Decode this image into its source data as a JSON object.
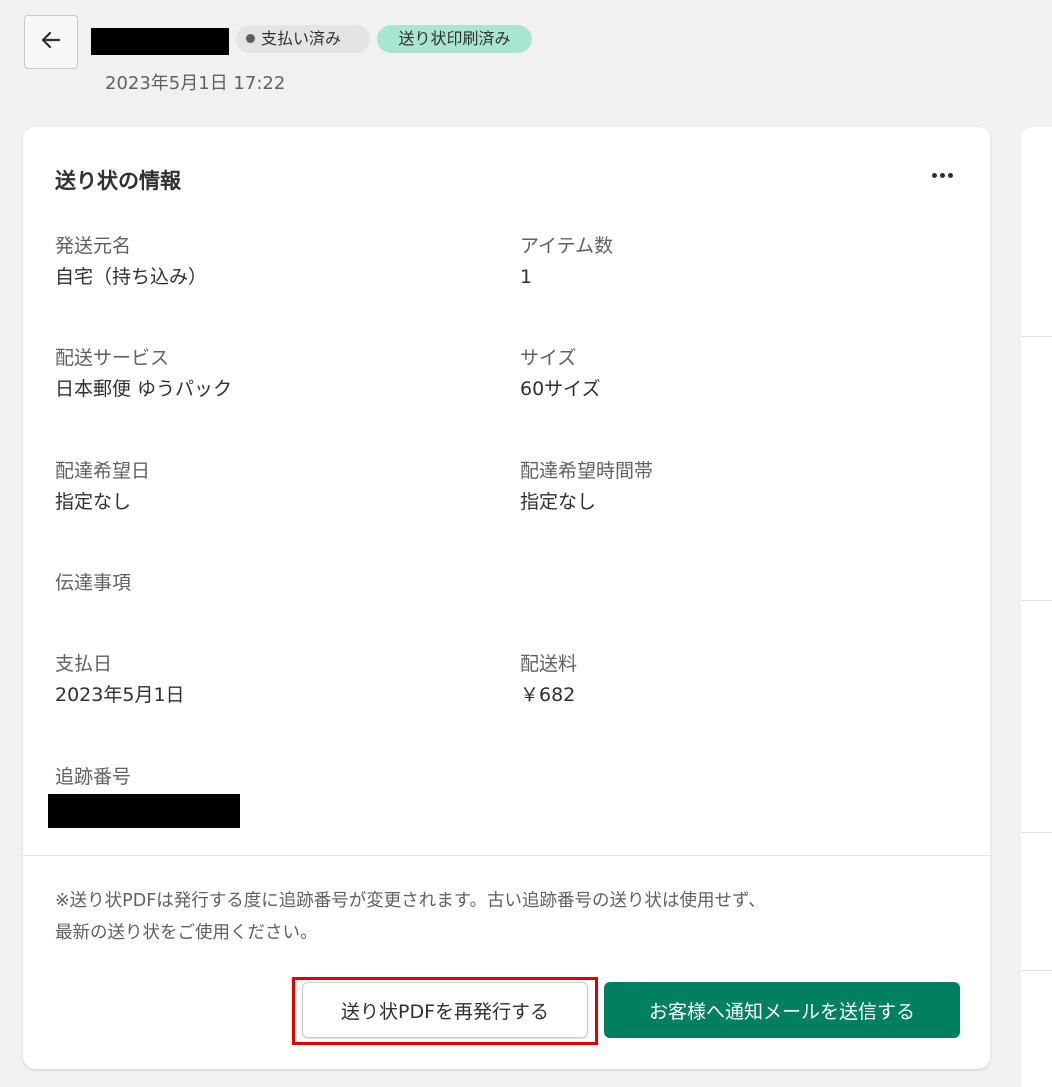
{
  "header": {
    "back_icon": "arrow-left-icon",
    "badge_paid": "支払い済み",
    "badge_printed": "送り状印刷済み",
    "order_date": "2023年5月1日 17:22"
  },
  "card": {
    "title": "送り状の情報",
    "more_icon": "more-horizontal-icon",
    "fields": {
      "sender_name": {
        "label": "発送元名",
        "value": "自宅（持ち込み）"
      },
      "item_count": {
        "label": "アイテム数",
        "value": "1"
      },
      "shipping_service": {
        "label": "配送サービス",
        "value": "日本郵便 ゆうパック"
      },
      "size": {
        "label": "サイズ",
        "value": "60サイズ"
      },
      "delivery_date": {
        "label": "配達希望日",
        "value": "指定なし"
      },
      "delivery_time": {
        "label": "配達希望時間帯",
        "value": "指定なし"
      },
      "message": {
        "label": "伝達事項",
        "value": ""
      },
      "payment_date": {
        "label": "支払日",
        "value": "2023年5月1日"
      },
      "shipping_fee": {
        "label": "配送料",
        "value": "￥682"
      },
      "tracking_number": {
        "label": "追跡番号"
      }
    },
    "note_line1": "※送り状PDFは発行する度に追跡番号が変更されます。古い追跡番号の送り状は使用せず、",
    "note_line2": "最新の送り状をご使用ください。",
    "reissue_button": "送り状PDFを再発行する",
    "notify_button": "お客様へ通知メールを送信する"
  },
  "colors": {
    "primary": "#008060",
    "badge_printed_bg": "#a8e6cf",
    "badge_paid_bg": "#e4e4e4",
    "highlight": "#e00000"
  }
}
